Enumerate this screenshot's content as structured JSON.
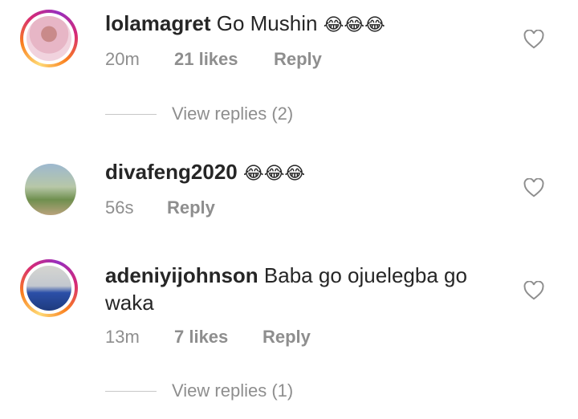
{
  "comments": [
    {
      "username": "lolamagret",
      "text": "Go Mushin",
      "emoji": "😂😂😂",
      "time": "20m",
      "likes": "21 likes",
      "reply": "Reply",
      "view_replies": "View replies (2)"
    },
    {
      "username": "divafeng2020",
      "text": "",
      "emoji": "😂😂😂",
      "time": "56s",
      "reply": "Reply"
    },
    {
      "username": "adeniyijohnson",
      "text": "Baba go ojuelegba go waka",
      "time": "13m",
      "likes": "7 likes",
      "reply": "Reply",
      "view_replies": "View replies (1)"
    }
  ],
  "icons": {
    "like": "heart-outline-icon",
    "emoji": "face-with-tears-of-joy"
  },
  "colors": {
    "text": "#262626",
    "secondary": "#8e8e8e",
    "divider": "#c7c7c7",
    "story_ring_start": "#feda75",
    "story_ring_end": "#962fbf"
  }
}
